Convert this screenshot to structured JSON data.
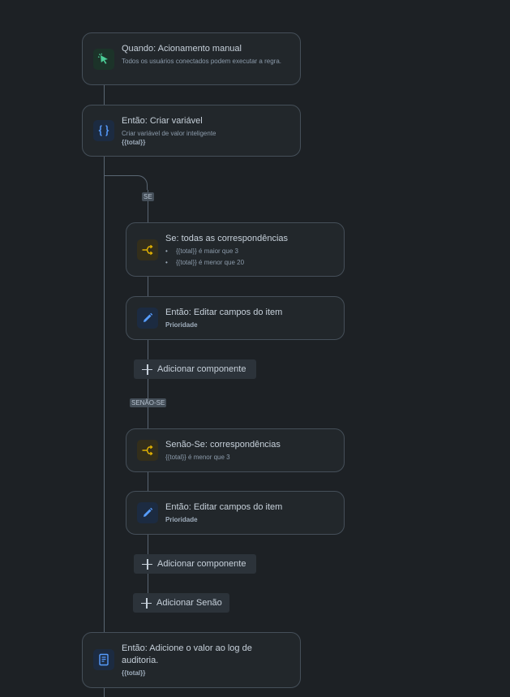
{
  "trigger": {
    "icon": "cursor-click-icon",
    "title": "Quando: Acionamento manual",
    "subtitle": "Todos os usuários conectados podem executar a regra."
  },
  "create_variable": {
    "icon": "braces-icon",
    "title": "Então: Criar variável",
    "subtitle": "Criar variável de valor inteligente",
    "value": "{{total}}"
  },
  "if_tag": "SE",
  "if_condition": {
    "icon": "branch-icon",
    "title": "Se: todas as correspondências",
    "items": [
      "{{total}} é maior que 3",
      "{{total}} é menor que 20"
    ]
  },
  "edit_fields_1": {
    "icon": "pencil-icon",
    "title": "Então: Editar campos do item",
    "field": "Prioridade"
  },
  "add_component_1": "Adicionar componente",
  "elseif_tag": "SENÃO-SE",
  "elseif_condition": {
    "icon": "branch-icon",
    "title": "Senão-Se: correspondências",
    "subtitle": "{{total}} é menor que 3"
  },
  "edit_fields_2": {
    "icon": "pencil-icon",
    "title": "Então: Editar campos do item",
    "field": "Prioridade"
  },
  "add_component_2": "Adicionar componente",
  "add_else": "Adicionar Senão",
  "audit_log": {
    "icon": "document-icon",
    "title": "Então: Adicione o valor ao log de auditoria.",
    "value": "{{total}}"
  },
  "colors": {
    "background": "#1d2125",
    "card": "#22272b",
    "green_icon": "#4bce97",
    "blue_icon": "#579dff",
    "yellow_icon": "#e2b203"
  }
}
